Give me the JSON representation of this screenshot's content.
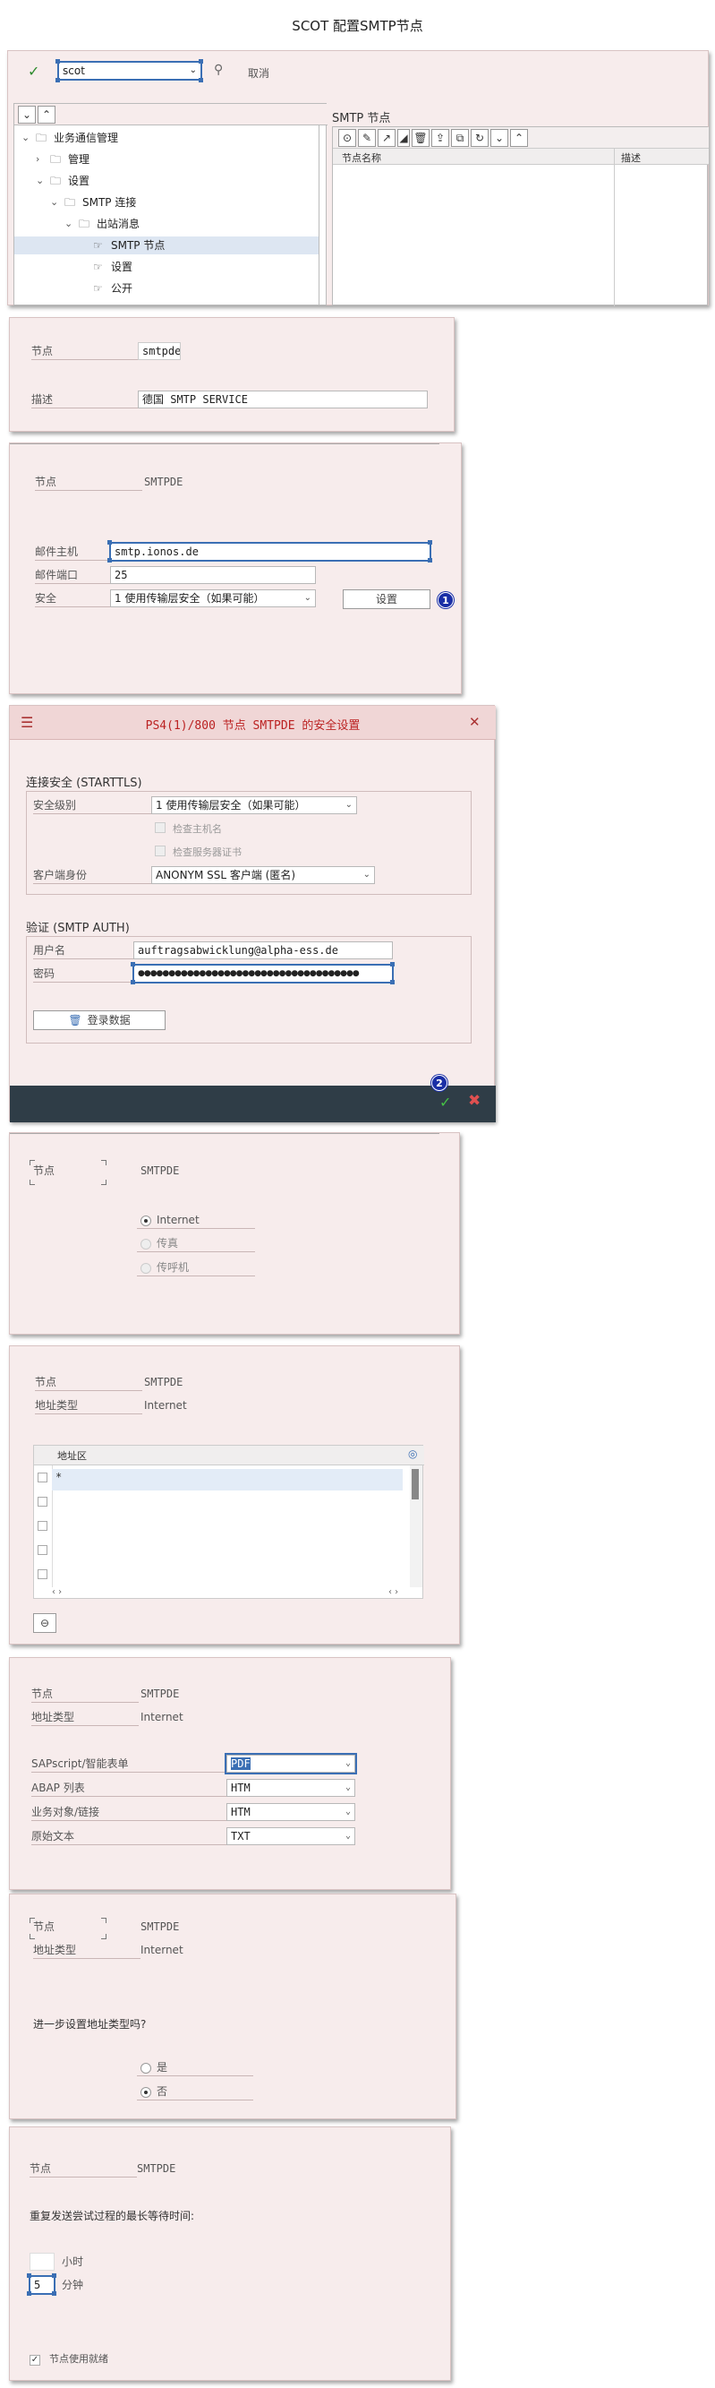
{
  "title": "SCOT 配置SMTP节点",
  "top": {
    "command_value": "scot",
    "cancel_label": "取消",
    "tree_items": [
      {
        "label": "业务通信管理",
        "indent": 0,
        "arrow": "v",
        "folder": true
      },
      {
        "label": "管理",
        "indent": 1,
        "arrow": ">",
        "folder": true
      },
      {
        "label": "设置",
        "indent": 1,
        "arrow": "v",
        "folder": true
      },
      {
        "label": "SMTP 连接",
        "indent": 2,
        "arrow": "v",
        "folder": true
      },
      {
        "label": "出站消息",
        "indent": 3,
        "arrow": "v",
        "folder": true
      },
      {
        "label": "SMTP 节点",
        "indent": 4,
        "arrow": "",
        "folder": false
      },
      {
        "label": "设置",
        "indent": 4,
        "arrow": "",
        "folder": false
      },
      {
        "label": "公开",
        "indent": 4,
        "arrow": "",
        "folder": false
      }
    ],
    "right_title": "SMTP 节点",
    "col_name": "节点名称",
    "col_desc": "描述"
  },
  "p1": {
    "node_label": "节点",
    "node_value": "smtpde",
    "desc_label": "描述",
    "desc_value": "德国 SMTP SERVICE"
  },
  "p2": {
    "node_label": "节点",
    "node_value": "SMTPDE",
    "host_label": "邮件主机",
    "host_value": "smtp.ionos.de",
    "port_label": "邮件端口",
    "port_value": "25",
    "security_label": "安全",
    "security_value": "1 使用传输层安全（如果可能）",
    "settings_button": "设置",
    "step": "1"
  },
  "p3": {
    "title": "PS4(1)/800 节点 SMTPDE 的安全设置",
    "sec_group": "连接安全 (STARTTLS)",
    "level_label": "安全级别",
    "level_value": "1 使用传输层安全（如果可能）",
    "check_host": "检查主机名",
    "check_cert": "检查服务器证书",
    "client_label": "客户端身份",
    "client_value": "ANONYM SSL 客户端 (匿名)",
    "auth_group": "验证 (SMTP AUTH)",
    "user_label": "用户名",
    "user_value": "auftragsabwicklung@alpha-ess.de",
    "pwd_label": "密码",
    "pwd_value": "●●●●●●●●●●●●●●●●●●●●●●●●●●●●●●●●●●●●",
    "login_button": "登录数据",
    "step": "2"
  },
  "p4": {
    "node_label": "节点",
    "node_value": "SMTPDE",
    "options": [
      "Internet",
      "传真",
      "传呼机"
    ],
    "selected": 0
  },
  "p5": {
    "node_label": "节点",
    "node_value": "SMTPDE",
    "type_label": "地址类型",
    "type_value": "Internet",
    "col_area": "地址区",
    "first_value": "*"
  },
  "p6": {
    "node_label": "节点",
    "node_value": "SMTPDE",
    "type_label": "地址类型",
    "type_value": "Internet",
    "rows": [
      {
        "label": "SAPscript/智能表单",
        "value": "PDF"
      },
      {
        "label": "ABAP 列表",
        "value": "HTM"
      },
      {
        "label": "业务对象/链接",
        "value": "HTM"
      },
      {
        "label": "原始文本",
        "value": "TXT"
      }
    ]
  },
  "p7": {
    "node_label": "节点",
    "node_value": "SMTPDE",
    "type_label": "地址类型",
    "type_value": "Internet",
    "question": "进一步设置地址类型吗?",
    "yes": "是",
    "no": "否"
  },
  "p8": {
    "node_label": "节点",
    "node_value": "SMTPDE",
    "question": "重复发送尝试过程的最长等待时间:",
    "hours_label": "小时",
    "minutes_value": "5",
    "minutes_label": "分钟",
    "ready_label": "节点使用就绪"
  },
  "colors": {
    "panel_bg": "#f7ecec",
    "accent": "#1a2fa6",
    "ok_green": "#2e8b2e",
    "cancel_red": "#c0392b"
  }
}
